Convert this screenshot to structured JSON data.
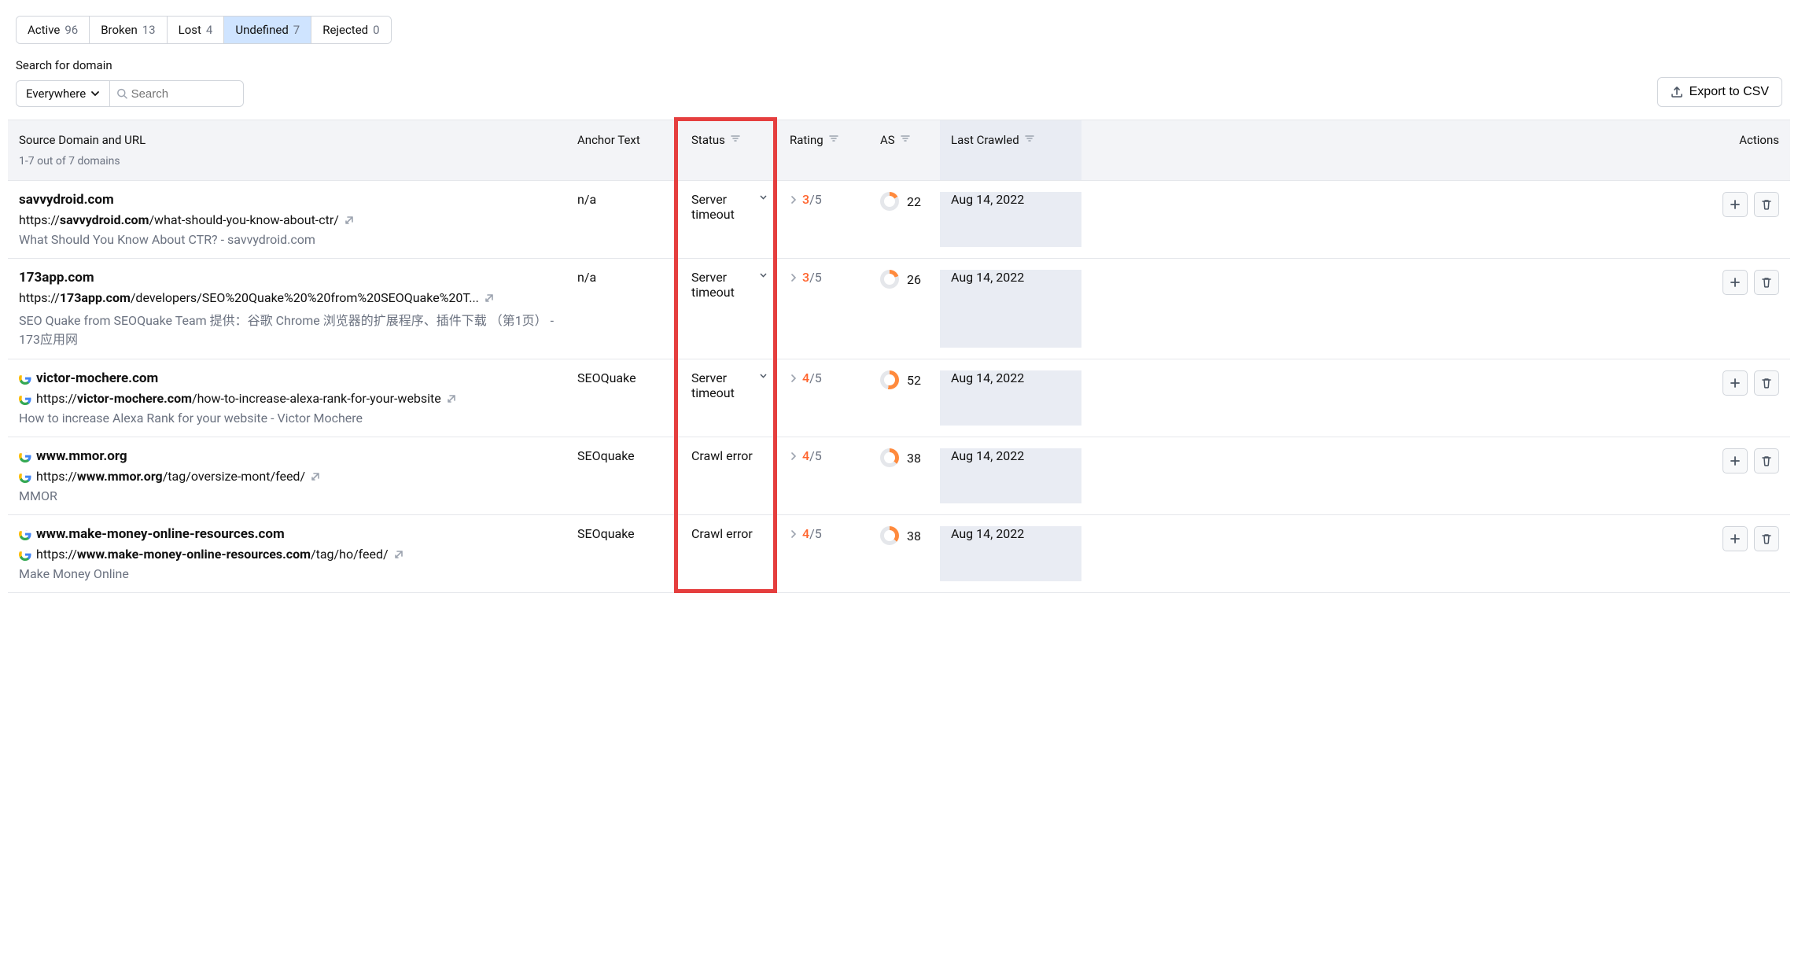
{
  "tabs": [
    {
      "label": "Active",
      "count": "96",
      "active": false
    },
    {
      "label": "Broken",
      "count": "13",
      "active": false
    },
    {
      "label": "Lost",
      "count": "4",
      "active": false
    },
    {
      "label": "Undefined",
      "count": "7",
      "active": true
    },
    {
      "label": "Rejected",
      "count": "0",
      "active": false
    }
  ],
  "search": {
    "label": "Search for domain",
    "scope": "Everywhere",
    "placeholder": "Search"
  },
  "export_label": "Export to CSV",
  "columns": {
    "source": "Source Domain and URL",
    "source_sub": "1-7 out of 7 domains",
    "anchor": "Anchor Text",
    "status": "Status",
    "rating": "Rating",
    "as": "AS",
    "crawled": "Last Crawled",
    "actions": "Actions"
  },
  "rows": [
    {
      "domain": "savvydroid.com",
      "url_pre": "https://",
      "url_bold": "savvydroid.com",
      "url_post": "/what-should-you-know-about-ctr/",
      "title": "What Should You Know About CTR? - savvydroid.com",
      "favicon": false,
      "anchor": "n/a",
      "status": "Server timeout",
      "status_chev": true,
      "rating_num": "3",
      "rating_denom": "/5",
      "as": "22",
      "as_deg": 60,
      "crawled": "Aug 14, 2022"
    },
    {
      "domain": "173app.com",
      "url_pre": "https://",
      "url_bold": "173app.com",
      "url_post": "/developers/SEO%20Quake%20%20from%20SEOQuake%20T...",
      "title": "SEO Quake from SEOQuake Team 提供：谷歌 Chrome 浏览器的扩展程序、插件下载 （第1页） - 173应用网",
      "favicon": false,
      "anchor": "n/a",
      "status": "Server timeout",
      "status_chev": true,
      "rating_num": "3",
      "rating_denom": "/5",
      "as": "26",
      "as_deg": 70,
      "crawled": "Aug 14, 2022"
    },
    {
      "domain": "victor-mochere.com",
      "url_pre": "https://",
      "url_bold": "victor-mochere.com",
      "url_post": "/how-to-increase-alexa-rank-for-your-website",
      "title": "How to increase Alexa Rank for your website - Victor Mochere",
      "favicon": true,
      "anchor": "SEOQuake",
      "status": "Server timeout",
      "status_chev": true,
      "rating_num": "4",
      "rating_denom": "/5",
      "as": "52",
      "as_deg": 190,
      "crawled": "Aug 14, 2022"
    },
    {
      "domain": "www.mmor.org",
      "url_pre": "https://",
      "url_bold": "www.mmor.org",
      "url_post": "/tag/oversize-mont/feed/",
      "title": "MMOR",
      "favicon": true,
      "anchor": "SEOquake",
      "status": "Crawl error",
      "status_chev": false,
      "rating_num": "4",
      "rating_denom": "/5",
      "as": "38",
      "as_deg": 130,
      "crawled": "Aug 14, 2022"
    },
    {
      "domain": "www.make-money-online-resources.com",
      "url_pre": "https://",
      "url_bold": "www.make-money-online-resources.com",
      "url_post": "/tag/ho/feed/",
      "title": "Make Money Online",
      "favicon": true,
      "anchor": "SEOquake",
      "status": "Crawl error",
      "status_chev": false,
      "rating_num": "4",
      "rating_denom": "/5",
      "as": "38",
      "as_deg": 130,
      "crawled": "Aug 14, 2022"
    }
  ]
}
